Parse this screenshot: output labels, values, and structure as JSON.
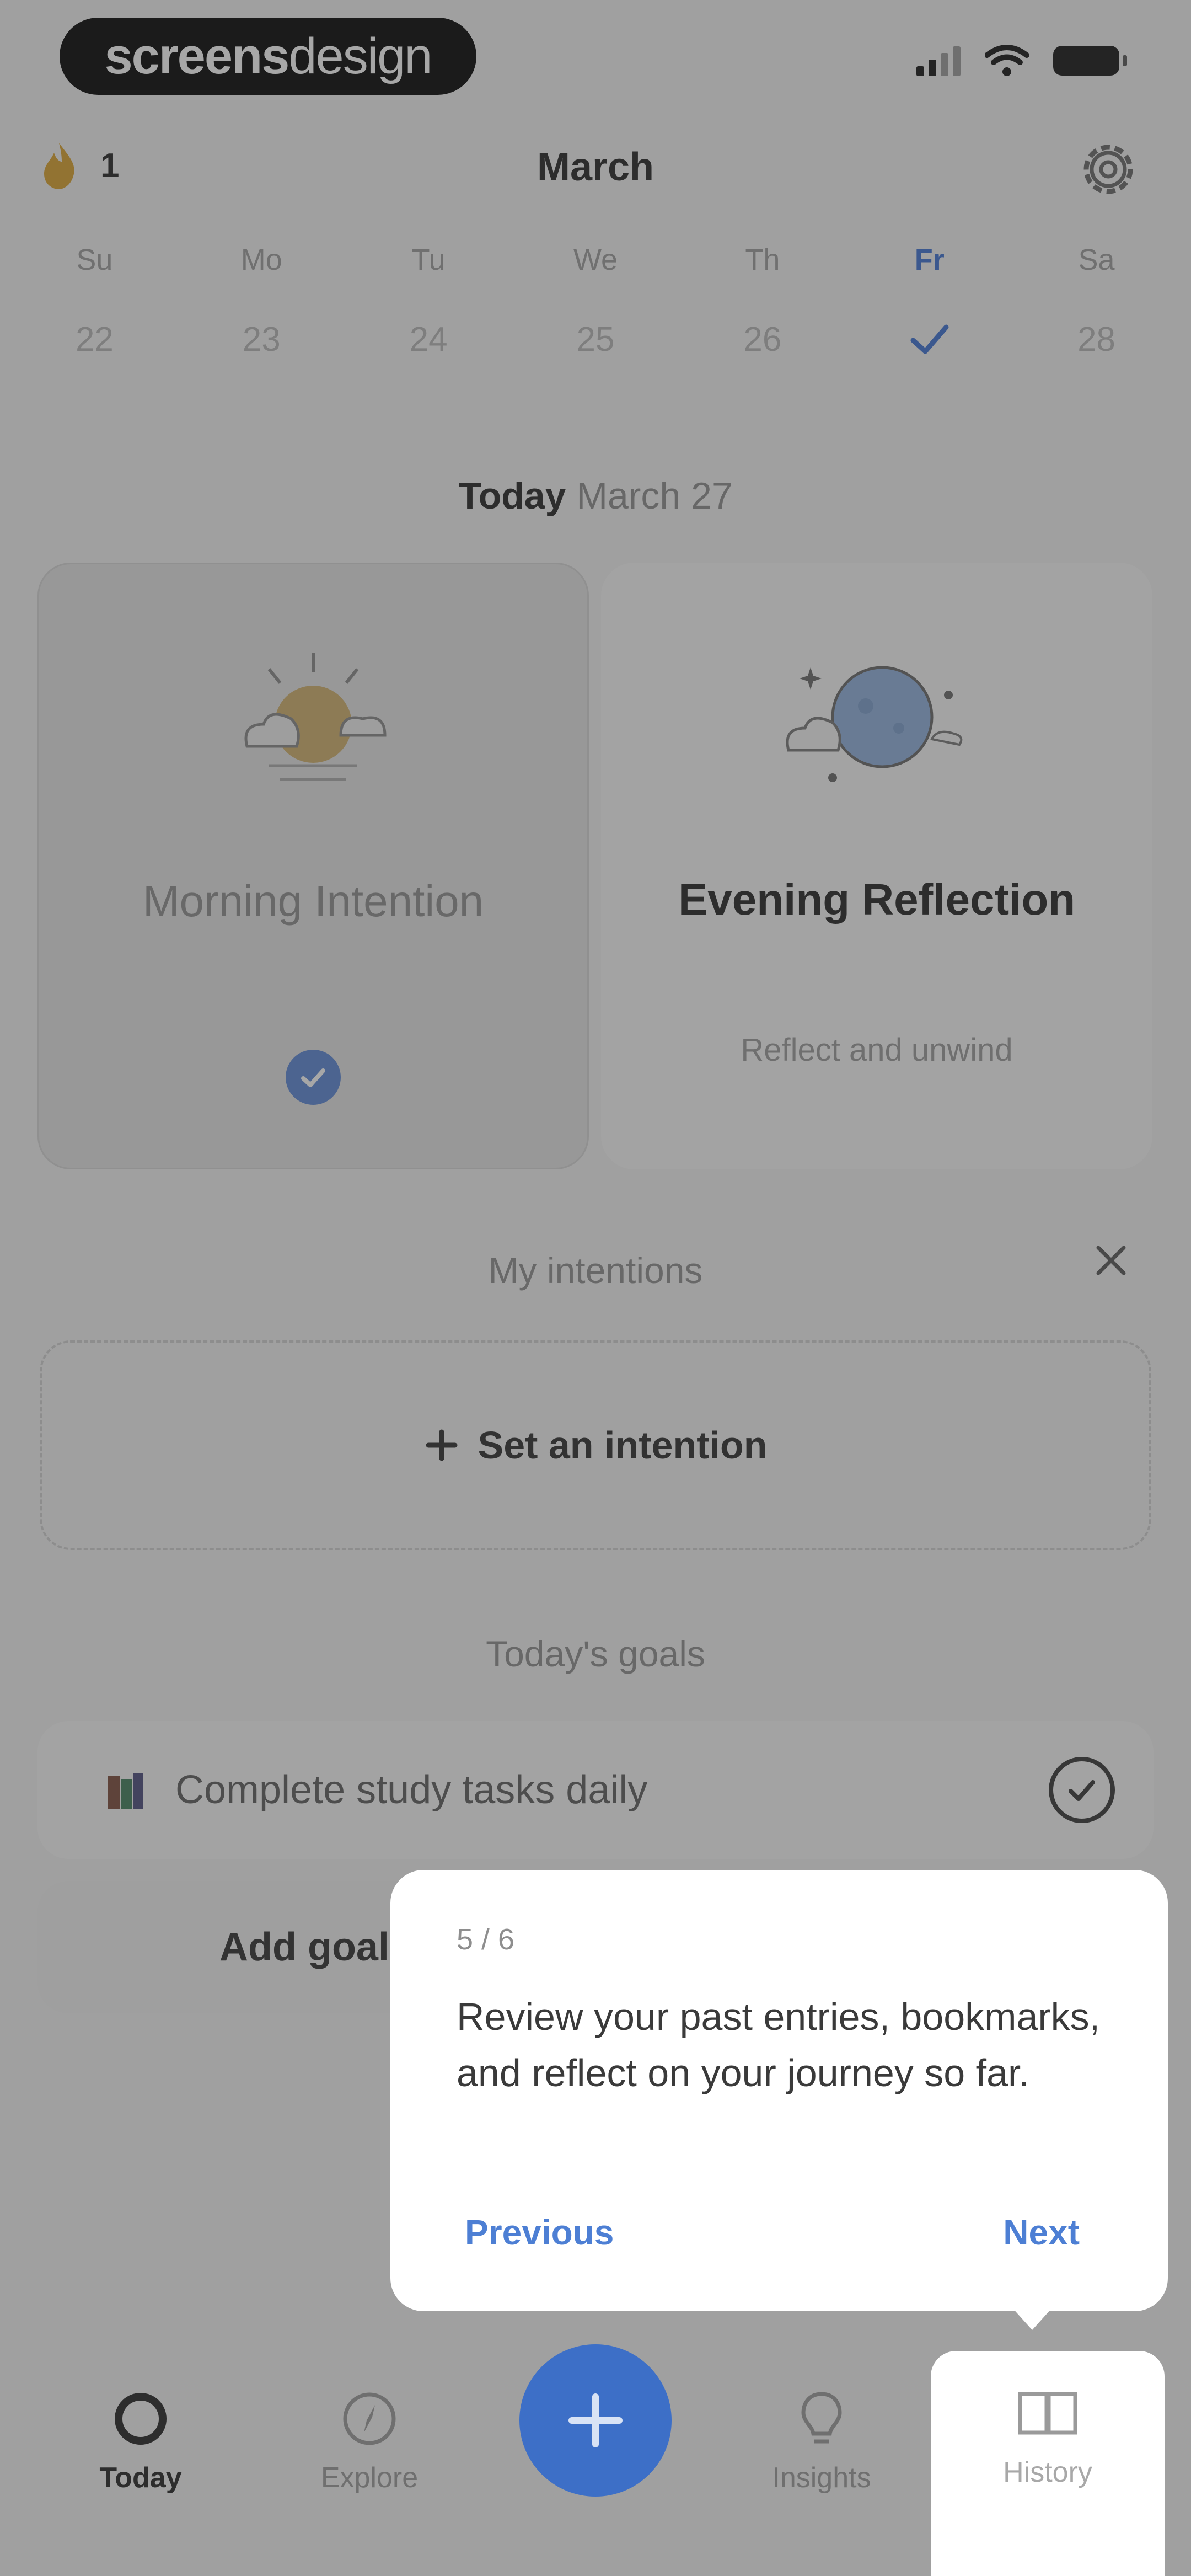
{
  "status_bar": {
    "brand_bold": "screens",
    "brand_light": "design"
  },
  "header": {
    "streak_count": "1",
    "month": "March"
  },
  "week": [
    {
      "name": "Su",
      "num": "22"
    },
    {
      "name": "Mo",
      "num": "23"
    },
    {
      "name": "Tu",
      "num": "24"
    },
    {
      "name": "We",
      "num": "25"
    },
    {
      "name": "Th",
      "num": "26"
    },
    {
      "name": "Fr",
      "num": "",
      "completed": true
    },
    {
      "name": "Sa",
      "num": "28"
    }
  ],
  "today": {
    "label": "Today",
    "date": "March 27"
  },
  "cards": {
    "morning": {
      "title": "Morning Intention",
      "completed": true
    },
    "evening": {
      "title": "Evening Reflection",
      "subtitle": "Reflect and unwind"
    }
  },
  "intentions": {
    "title": "My intentions",
    "add_label": "Set an intention"
  },
  "goals": {
    "title": "Today's goals",
    "items": [
      {
        "label": "Complete study tasks daily"
      }
    ],
    "add_label": "Add goal"
  },
  "tooltip": {
    "step": "5 / 6",
    "text": "Review your past entries, bookmarks, and reflect on your journey so far.",
    "previous": "Previous",
    "next": "Next"
  },
  "tabs": [
    {
      "label": "Today",
      "icon": "today-icon"
    },
    {
      "label": "Explore",
      "icon": "compass-icon"
    },
    {
      "label": "Insights",
      "icon": "lightbulb-icon"
    },
    {
      "label": "History",
      "icon": "book-icon"
    }
  ],
  "colors": {
    "accent": "#3d6fc7",
    "link": "#4d7fd4",
    "overlay": "rgba(60,60,60,0.45)"
  }
}
